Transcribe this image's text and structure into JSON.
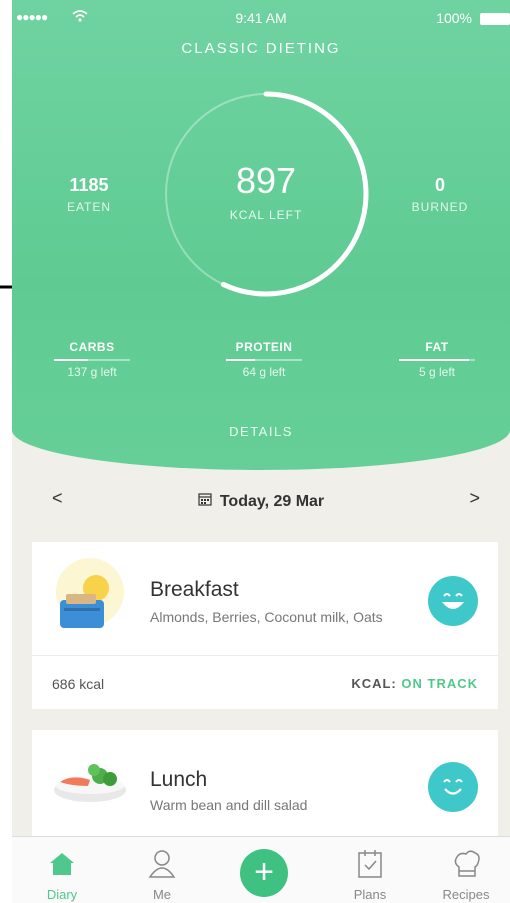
{
  "status_bar": {
    "signal": "●●●●●",
    "time": "9:41 AM",
    "battery": "100%"
  },
  "plan": {
    "title": "CLASSIC DIETING"
  },
  "summary": {
    "kcal_left": "897",
    "kcal_left_label": "KCAL LEFT",
    "eaten": "1185",
    "eaten_label": "EATEN",
    "burned": "0",
    "burned_label": "BURNED",
    "ring_progress": 0.57
  },
  "macros": [
    {
      "name": "CARBS",
      "left": "137 g left",
      "progress": 0.45
    },
    {
      "name": "PROTEIN",
      "left": "64 g left",
      "progress": 0.38
    },
    {
      "name": "FAT",
      "left": "5 g left",
      "progress": 0.92
    }
  ],
  "details_label": "DETAILS",
  "date_nav": {
    "prev": "<",
    "date": "Today, 29 Mar",
    "next": ">"
  },
  "meals": [
    {
      "title": "Breakfast",
      "items": "Almonds, Berries, Coconut milk, Oats",
      "kcal": "686 kcal",
      "status_label": "KCAL:",
      "status_value": "ON TRACK"
    },
    {
      "title": "Lunch",
      "items": "Warm bean and dill salad"
    }
  ],
  "tabs": [
    {
      "label": "Diary",
      "icon": "home-icon",
      "active": true
    },
    {
      "label": "Me",
      "icon": "person-icon"
    },
    {
      "label": "",
      "icon": "add-icon"
    },
    {
      "label": "Plans",
      "icon": "calendar-check-icon"
    },
    {
      "label": "Recipes",
      "icon": "chef-hat-icon"
    }
  ],
  "colors": {
    "accent": "#5fcb93",
    "face": "#3ec8c9",
    "on_track": "#4fc88c"
  }
}
